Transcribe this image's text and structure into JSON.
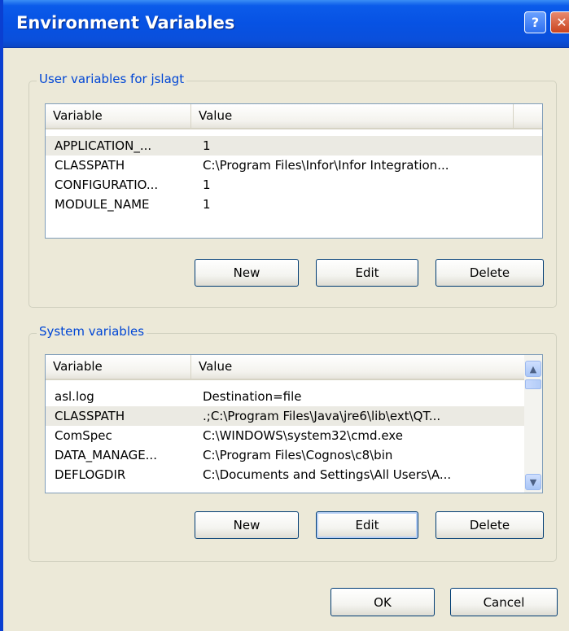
{
  "window": {
    "title": "Environment Variables",
    "help_glyph": "?",
    "close_glyph": "✕"
  },
  "user_group": {
    "label": "User variables for jslagt",
    "columns": [
      "Variable",
      "Value"
    ],
    "rows": [
      {
        "variable": "APPLICATION_...",
        "value": "1"
      },
      {
        "variable": "CLASSPATH",
        "value": "C:\\Program Files\\Infor\\Infor Integration..."
      },
      {
        "variable": "CONFIGURATIO...",
        "value": "1"
      },
      {
        "variable": "MODULE_NAME",
        "value": "1"
      }
    ],
    "buttons": {
      "new": "New",
      "edit": "Edit",
      "delete": "Delete"
    }
  },
  "system_group": {
    "label": "System variables",
    "columns": [
      "Variable",
      "Value"
    ],
    "rows": [
      {
        "variable": "asl.log",
        "value": "Destination=file"
      },
      {
        "variable": "CLASSPATH",
        "value": ".;C:\\Program Files\\Java\\jre6\\lib\\ext\\QT..."
      },
      {
        "variable": "ComSpec",
        "value": "C:\\WINDOWS\\system32\\cmd.exe"
      },
      {
        "variable": "DATA_MANAGE...",
        "value": "C:\\Program Files\\Cognos\\c8\\bin"
      },
      {
        "variable": "DEFLOGDIR",
        "value": "C:\\Documents and Settings\\All Users\\A..."
      }
    ],
    "buttons": {
      "new": "New",
      "edit": "Edit",
      "delete": "Delete"
    }
  },
  "dialog_buttons": {
    "ok": "OK",
    "cancel": "Cancel"
  },
  "icons": {
    "scroll_up": "scroll-up-arrow-icon",
    "scroll_down": "scroll-down-arrow-icon"
  },
  "colors": {
    "title_bar": "#0752e3",
    "group_label": "#0046d5",
    "dialog_bg": "#ece9d8"
  }
}
